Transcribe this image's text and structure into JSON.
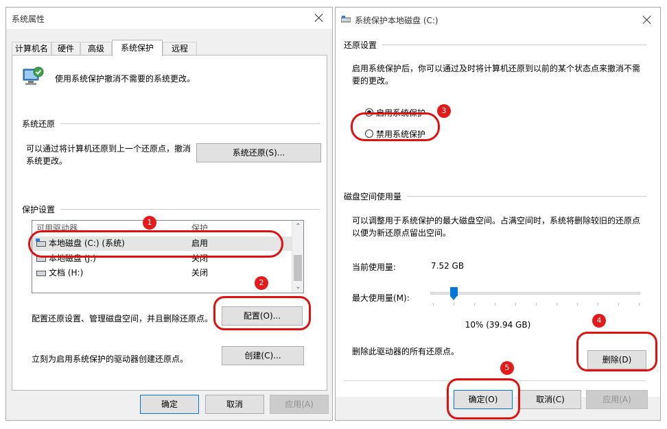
{
  "left_window": {
    "title": "系统属性",
    "tabs": [
      "计算机名",
      "硬件",
      "高级",
      "系统保护",
      "远程"
    ],
    "active_tab": "系统保护",
    "intro": "使用系统保护撤消不需要的系统更改。",
    "restore_group": {
      "label": "系统还原",
      "desc_line1": "可以通过将计算机还原到上一个还原点，撤消",
      "desc_line2": "系统更改。",
      "button": "系统还原(S)..."
    },
    "protect_group": {
      "label": "保护设置",
      "columns": [
        "可用驱动器",
        "保护"
      ],
      "rows": [
        {
          "drive": "本地磁盘 (C:) (系统)",
          "status": "启用"
        },
        {
          "drive": "本地磁盘 (J:)",
          "status": "关闭"
        },
        {
          "drive": "文档 (H:)",
          "status": "关闭"
        }
      ]
    },
    "config_desc": "配置还原设置、管理磁盘空间，并且删除还原点。",
    "config_button": "配置(O)...",
    "create_desc": "立刻为启用系统保护的驱动器创建还原点。",
    "create_button": "创建(C)...",
    "ok": "确定",
    "cancel": "取消",
    "apply": "应用(A)"
  },
  "right_window": {
    "title": "系统保护本地磁盘 (C:)",
    "restore_section": "还原设置",
    "restore_desc_line1": "启用系统保护后，你可以通过及时将计算机还原到以前的某个状态点来撤消不需",
    "restore_desc_line2": "要的更改。",
    "radio_enable": "启用系统保护",
    "radio_disable": "禁用系统保护",
    "selected_radio": "enable",
    "disk_section": "磁盘空间使用量",
    "disk_desc_line1": "可以调整用于系统保护的最大磁盘空间。占满空间时，系统将删除较旧的还原点",
    "disk_desc_line2": "以便为新还原点留出空间。",
    "current_usage_label": "当前使用量:",
    "current_usage_value": "7.52 GB",
    "max_usage_label": "最大使用量(M):",
    "max_usage_percent": 10,
    "max_usage_text": "10% (39.94 GB)",
    "delete_desc": "删除此驱动器的所有还原点。",
    "delete_button": "删除(D)",
    "ok": "确定(O)",
    "cancel": "取消(C)",
    "apply": "应用(A)"
  },
  "badges": [
    "1",
    "2",
    "3",
    "4",
    "5"
  ],
  "colors": {
    "annotation": "#e01010",
    "accent": "#0078d7"
  }
}
